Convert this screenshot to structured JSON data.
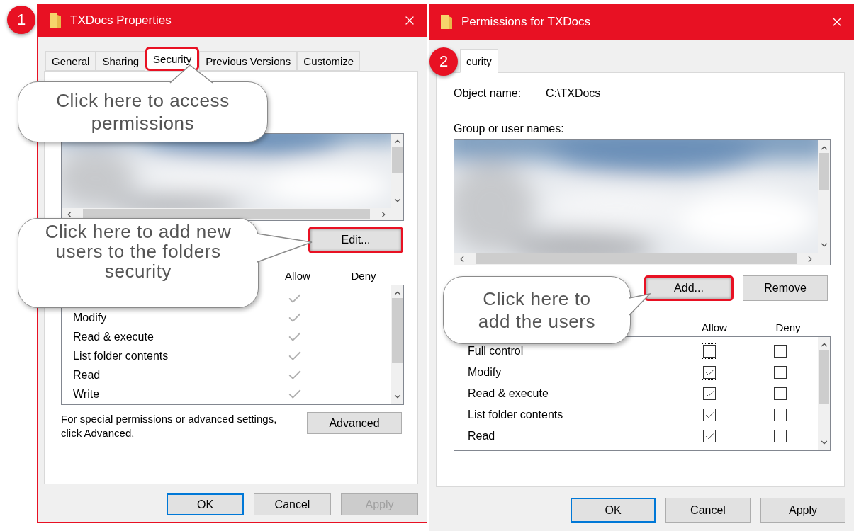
{
  "properties_dialog": {
    "step": "1",
    "title": "TXDocs Properties",
    "tabs": [
      {
        "label": "General",
        "selected": false,
        "highlighted": false
      },
      {
        "label": "Sharing",
        "selected": false,
        "highlighted": false
      },
      {
        "label": "Security",
        "selected": true,
        "highlighted": true
      },
      {
        "label": "Previous Versions",
        "selected": false,
        "highlighted": false
      },
      {
        "label": "Customize",
        "selected": false,
        "highlighted": false
      }
    ],
    "edit_button": {
      "label": "Edit...",
      "highlighted": true
    },
    "permission_headers": [
      "Allow",
      "Deny"
    ],
    "permissions": [
      {
        "allow": true
      },
      {
        "name": "Modify",
        "allow": true
      },
      {
        "name": "Read & execute",
        "allow": true
      },
      {
        "name": "List folder contents",
        "allow": true
      },
      {
        "name": "Read",
        "allow": true
      },
      {
        "name": "Write",
        "allow": true
      }
    ],
    "advanced_note": "For special permissions or advanced settings, click Advanced.",
    "advanced_button": "Advanced",
    "buttons": [
      {
        "label": "OK",
        "primary": true,
        "disabled": false
      },
      {
        "label": "Cancel",
        "primary": false,
        "disabled": false
      },
      {
        "label": "Apply",
        "primary": false,
        "disabled": true
      }
    ]
  },
  "permissions_dialog": {
    "step": "2",
    "title": "Permissions for TXDocs",
    "tabs": [
      {
        "label": "curity",
        "selected": true,
        "highlighted": false
      }
    ],
    "object_name_label": "Object name:",
    "object_name": "C:\\TXDocs",
    "group_label": "Group or user names:",
    "list_buttons": [
      {
        "label": "Add...",
        "highlighted": true
      },
      {
        "label": "Remove",
        "highlighted": false
      }
    ],
    "permission_headers": [
      "Allow",
      "Deny"
    ],
    "permissions": [
      {
        "name": "Full control",
        "allow": false,
        "deny": false,
        "focused": true
      },
      {
        "name": "Modify",
        "allow": true,
        "deny": false,
        "focused": true
      },
      {
        "name": "Read & execute",
        "allow": true,
        "deny": false,
        "focused": false
      },
      {
        "name": "List folder contents",
        "allow": true,
        "deny": false,
        "focused": false
      },
      {
        "name": "Read",
        "allow": true,
        "deny": false,
        "focused": false
      }
    ],
    "buttons": [
      {
        "label": "OK",
        "primary": true,
        "disabled": false
      },
      {
        "label": "Cancel",
        "primary": false,
        "disabled": false
      },
      {
        "label": "Apply",
        "primary": false,
        "disabled": false
      }
    ]
  },
  "callouts": [
    "Click here to access permissions",
    "Click here to add new users to the folders security",
    "Click here to add the users"
  ]
}
